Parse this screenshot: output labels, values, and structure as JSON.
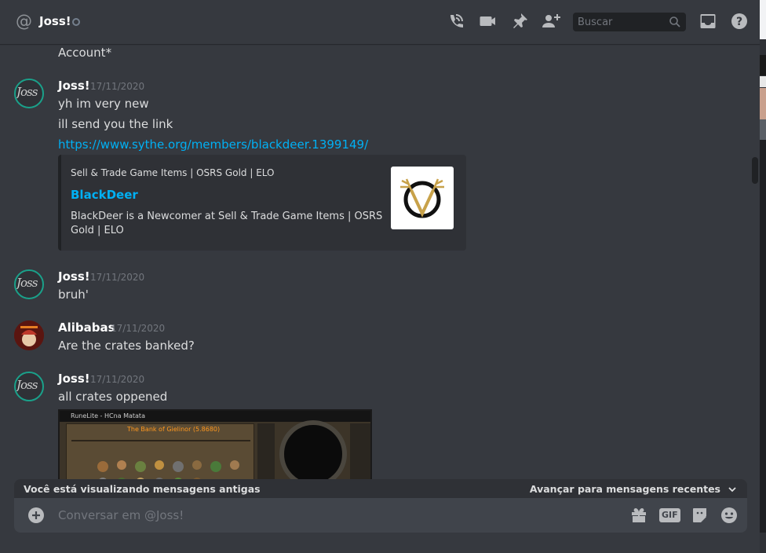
{
  "header": {
    "channel_name": "Joss!",
    "search_placeholder": "Buscar",
    "icons": [
      "start-voice-call-icon",
      "start-video-call-icon",
      "pinned-messages-icon",
      "add-friends-to-dm-icon",
      "inbox-icon",
      "help-icon"
    ]
  },
  "messages": {
    "prev_line": "Account*",
    "m1": {
      "author": "Joss!",
      "timestamp": "17/11/2020",
      "lines": [
        "yh im very new",
        "ill send you the link"
      ],
      "link": "https://www.sythe.org/members/blackdeer.1399149/",
      "embed": {
        "provider": "Sell & Trade Game Items | OSRS Gold | ELO",
        "title": "BlackDeer",
        "description": "BlackDeer is a Newcomer at Sell & Trade Game Items | OSRS Gold | ELO"
      }
    },
    "m2": {
      "author": "Joss!",
      "timestamp": "17/11/2020",
      "text": "bruh'"
    },
    "m3": {
      "author": "Alibabas",
      "timestamp": "17/11/2020",
      "text": "Are the crates banked?"
    },
    "m4": {
      "author": "Joss!",
      "timestamp": "17/11/2020",
      "text": "all crates oppened",
      "attachment": {
        "window_title": "RuneLite - HCna Matata",
        "bank_title": "The Bank of Gielinor (5.8680)"
      }
    }
  },
  "old_messages_bar": {
    "left_text": "Você está visualizando mensagens antigas",
    "right_text": "Avançar para mensagens recentes"
  },
  "composer": {
    "placeholder": "Conversar em @Joss!",
    "gif_label": "GIF"
  },
  "colors": {
    "background": "#36393f",
    "link": "#00b0f4",
    "header_text": "#ffffff",
    "muted": "#72767d"
  }
}
